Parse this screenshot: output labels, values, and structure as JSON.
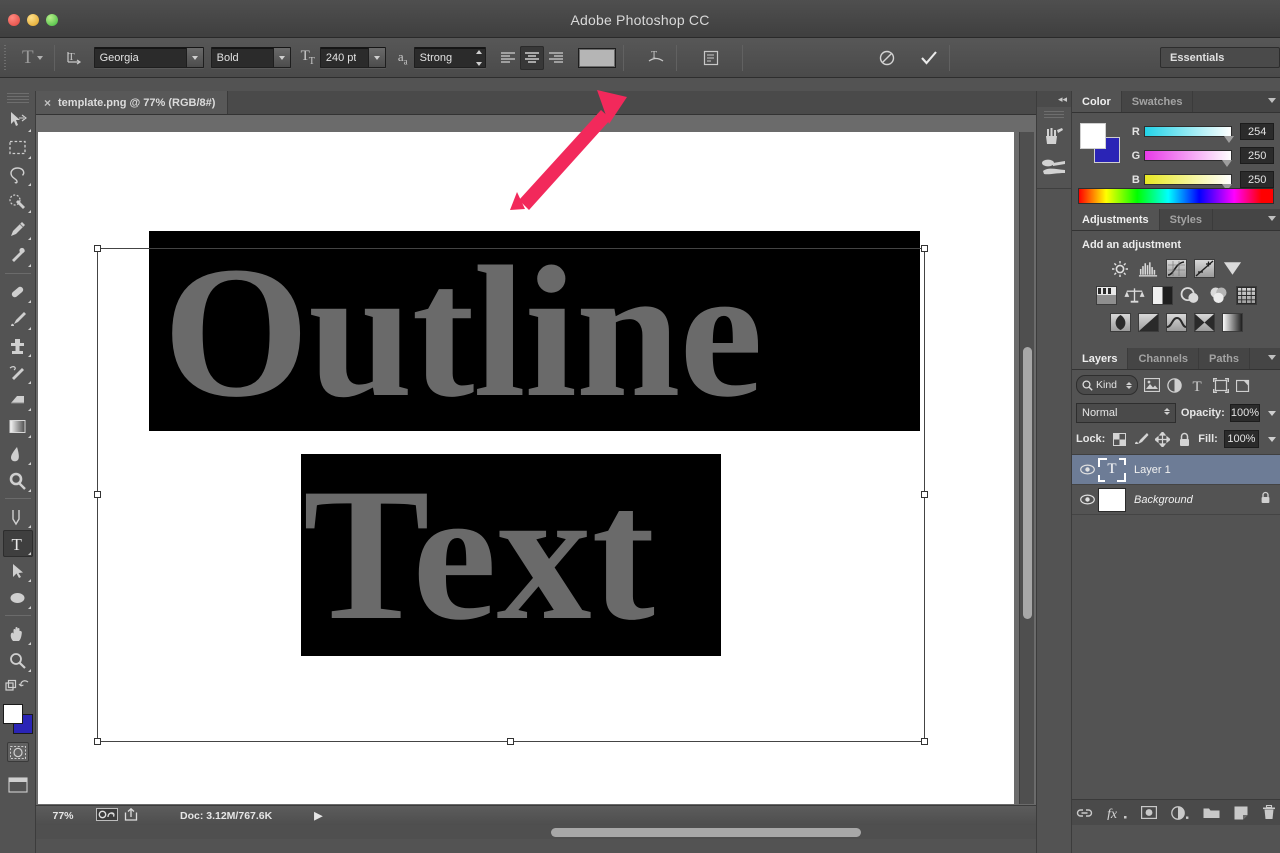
{
  "window": {
    "title": "Adobe Photoshop CC",
    "traffic_lights": [
      "close",
      "minimize",
      "maximize"
    ]
  },
  "options_bar": {
    "tool_icon": "text-tool-icon",
    "orientation_icon": "toggle-text-orientation-icon",
    "font_family": "Georgia",
    "font_style": "Bold",
    "size_icon": "font-size-icon",
    "font_size": "240 pt",
    "aa_icon": "anti-alias-icon",
    "anti_alias": "Strong",
    "align_left_icon": "align-left-icon",
    "align_center_icon": "align-center-icon",
    "align_right_icon": "align-right-icon",
    "text_color": "#b5b5b5",
    "warp_icon": "warp-text-icon",
    "panels_icon": "character-paragraph-panels-icon",
    "cancel_icon": "cancel-edit-icon",
    "commit_icon": "commit-edit-icon",
    "workspace": "Essentials"
  },
  "toolbar": {
    "tools": [
      {
        "name": "move-tool",
        "active": false
      },
      {
        "name": "rectangular-marquee-tool",
        "active": false
      },
      {
        "name": "lasso-tool",
        "active": false
      },
      {
        "name": "quick-selection-tool",
        "active": false
      },
      {
        "name": "crop-tool",
        "active": false
      },
      {
        "name": "eyedropper-tool",
        "active": false
      },
      {
        "name": "spot-healing-brush-tool",
        "active": false
      },
      {
        "name": "brush-tool",
        "active": false
      },
      {
        "name": "clone-stamp-tool",
        "active": false
      },
      {
        "name": "history-brush-tool",
        "active": false
      },
      {
        "name": "eraser-tool",
        "active": false
      },
      {
        "name": "gradient-tool",
        "active": false
      },
      {
        "name": "blur-tool",
        "active": false
      },
      {
        "name": "dodge-tool",
        "active": false
      },
      {
        "name": "pen-tool",
        "active": false
      },
      {
        "name": "horizontal-type-tool",
        "active": true
      },
      {
        "name": "path-selection-tool",
        "active": false
      },
      {
        "name": "ellipse-tool",
        "active": false
      },
      {
        "name": "hand-tool",
        "active": false
      },
      {
        "name": "zoom-tool",
        "active": false
      }
    ],
    "foreground_color": "#ffffff",
    "background_color": "#2a24b6",
    "quick_mask_icon": "quick-mask-icon",
    "screen_mode_icon": "screen-mode-icon"
  },
  "document": {
    "tab_label": "template.png @ 77% (RGB/8#)",
    "close_glyph": "×",
    "text_blocks": [
      {
        "text": "Outline",
        "fill": "#6a6a6a",
        "background": "#000000"
      },
      {
        "text": "Text",
        "fill": "#6a6a6a",
        "background": "#000000"
      }
    ]
  },
  "status_bar": {
    "zoom": "77%",
    "icons": [
      "settings-icon",
      "share-icon"
    ],
    "doc_info": "Doc: 3.12M/767.6K",
    "arrow_glyph": "▶"
  },
  "icon_dock": {
    "collapse_label": "◂◂",
    "icons": [
      "history-icon",
      "brush-presets-icon"
    ]
  },
  "panels": {
    "color": {
      "tabs": [
        {
          "label": "Color",
          "active": true
        },
        {
          "label": "Swatches",
          "active": false
        }
      ],
      "channels": [
        {
          "label": "R",
          "value": "254"
        },
        {
          "label": "G",
          "value": "250"
        },
        {
          "label": "B",
          "value": "250"
        }
      ],
      "foreground_color": "#ffffff",
      "background_color": "#2a24b6"
    },
    "adjustments": {
      "tabs": [
        {
          "label": "Adjustments",
          "active": true
        },
        {
          "label": "Styles",
          "active": false
        }
      ],
      "heading": "Add an adjustment",
      "rows": [
        [
          "brightness-contrast-icon",
          "levels-icon",
          "curves-icon",
          "exposure-icon",
          "vibrance-icon"
        ],
        [
          "hue-saturation-icon",
          "color-balance-icon",
          "black-white-icon",
          "photo-filter-icon",
          "channel-mixer-icon",
          "color-lookup-icon"
        ],
        [
          "invert-icon",
          "posterize-icon",
          "threshold-icon",
          "selective-color-icon",
          "gradient-map-icon"
        ]
      ]
    },
    "layers": {
      "tabs": [
        {
          "label": "Layers",
          "active": true
        },
        {
          "label": "Channels",
          "active": false
        },
        {
          "label": "Paths",
          "active": false
        }
      ],
      "filter_label": "Kind",
      "filter_icons": [
        "filter-pixel-icon",
        "filter-adjustment-icon",
        "filter-type-icon",
        "filter-shape-icon",
        "filter-smart-object-icon"
      ],
      "blend_mode": "Normal",
      "opacity_label": "Opacity:",
      "opacity_value": "100%",
      "lock_label": "Lock:",
      "lock_icons": [
        "lock-transparent-pixels-icon",
        "lock-image-pixels-icon",
        "lock-position-icon",
        "lock-all-icon"
      ],
      "fill_label": "Fill:",
      "fill_value": "100%",
      "rows": [
        {
          "name": "Layer 1",
          "kind": "type",
          "visible": true,
          "selected": true,
          "locked": false,
          "italic": false
        },
        {
          "name": "Background",
          "kind": "image",
          "visible": true,
          "selected": false,
          "locked": true,
          "italic": true
        }
      ],
      "footer_icons": [
        "link-layers-icon",
        "layer-style-icon",
        "layer-mask-icon",
        "new-fill-adjustment-icon",
        "new-group-icon",
        "new-layer-icon",
        "delete-layer-icon"
      ]
    }
  },
  "annotation": {
    "arrow_color": "#f2295b",
    "points_at": "text-color-swatch"
  }
}
